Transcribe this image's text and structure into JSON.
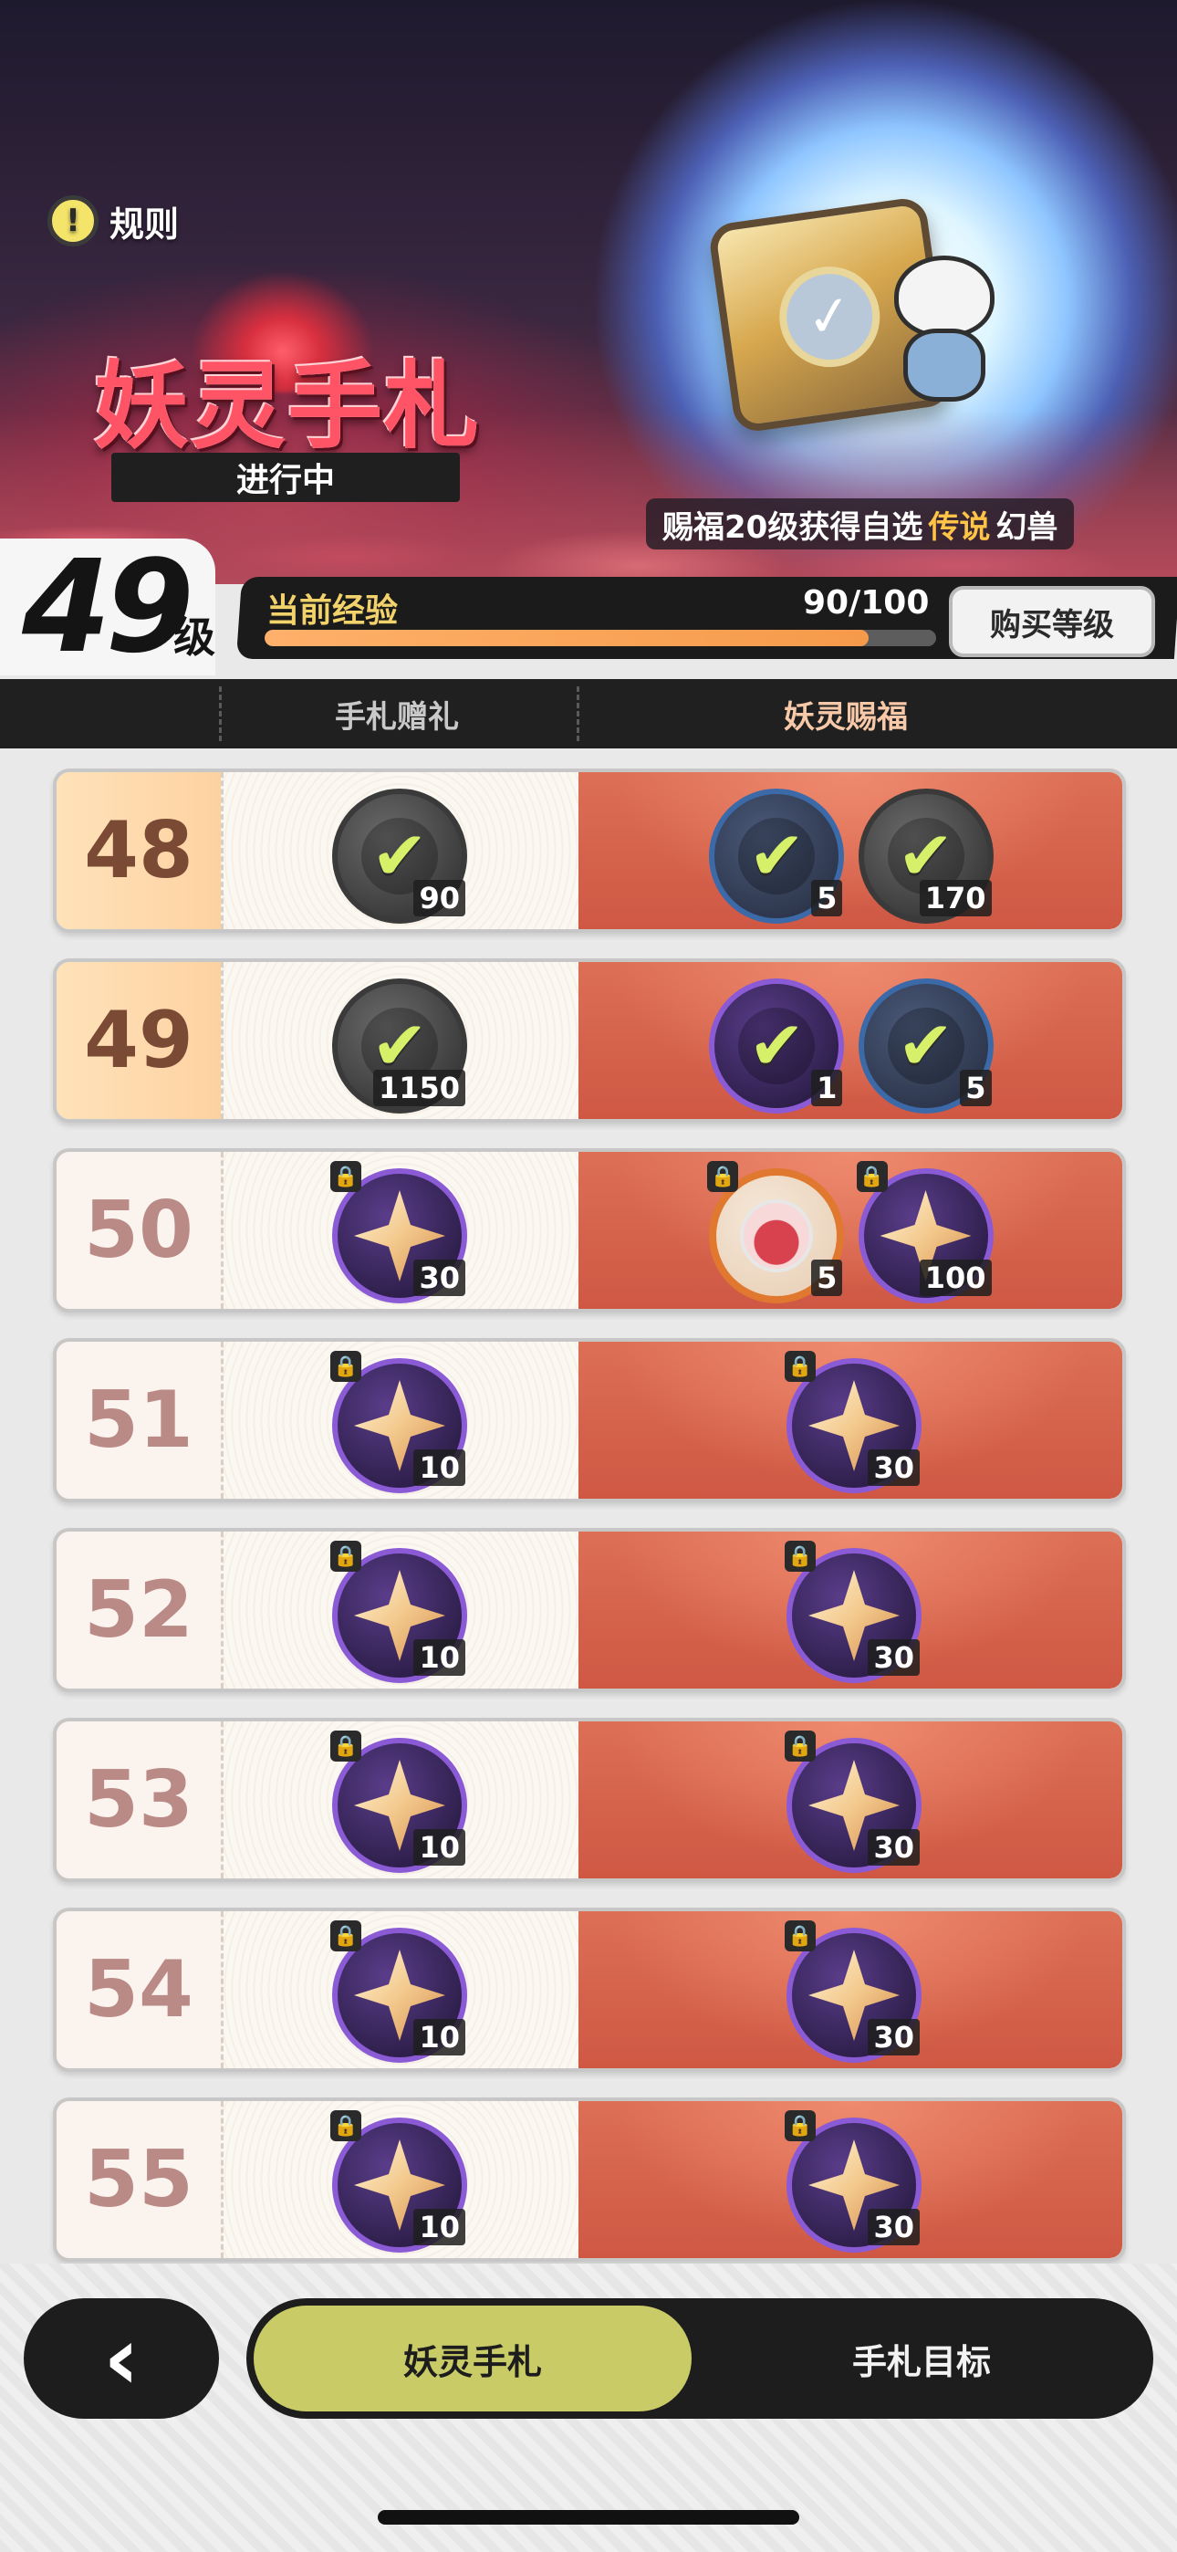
{
  "banner": {
    "rules_label": "规则",
    "event_title": "妖灵手札",
    "status": "进行中",
    "reward_caption_prefix": "赐福20级获得自选",
    "reward_caption_highlight": "传说",
    "reward_caption_suffix": "幻兽"
  },
  "level": {
    "current": "49",
    "unit": "级",
    "exp_label": "当前经验",
    "exp_text": "90/100",
    "exp_progress_percent": 90,
    "buy_label": "购买等级"
  },
  "columns": {
    "free_header": "手札赠礼",
    "paid_header": "妖灵赐福"
  },
  "rows": [
    {
      "level": "48",
      "state": "reached",
      "free": [
        {
          "icon": "bag-icon",
          "tier": "gray",
          "qty": "90",
          "claimed": true
        }
      ],
      "paid": [
        {
          "icon": "stone-icon",
          "tier": "blue",
          "qty": "5",
          "claimed": true
        },
        {
          "icon": "bag-icon",
          "tier": "gray",
          "qty": "170",
          "claimed": true
        }
      ]
    },
    {
      "level": "49",
      "state": "reached",
      "free": [
        {
          "icon": "orb-icon",
          "tier": "gray",
          "qty": "1150",
          "claimed": true
        }
      ],
      "paid": [
        {
          "icon": "scroll-icon",
          "tier": "purple",
          "qty": "1",
          "claimed": true
        },
        {
          "icon": "pickaxe-icon",
          "tier": "blue",
          "qty": "5",
          "claimed": true
        }
      ]
    },
    {
      "level": "50",
      "state": "locked",
      "free": [
        {
          "icon": "star-crystal-icon",
          "tier": "purple",
          "qty": "30",
          "claimed": false
        }
      ],
      "paid": [
        {
          "icon": "paw-token-icon",
          "tier": "orange",
          "qty": "5",
          "claimed": false
        },
        {
          "icon": "star-crystal-icon",
          "tier": "purple",
          "qty": "100",
          "claimed": false
        }
      ]
    },
    {
      "level": "51",
      "state": "locked",
      "free": [
        {
          "icon": "star-crystal-icon",
          "tier": "purple",
          "qty": "10",
          "claimed": false
        }
      ],
      "paid": [
        {
          "icon": "star-crystal-icon",
          "tier": "purple",
          "qty": "30",
          "claimed": false
        }
      ]
    },
    {
      "level": "52",
      "state": "locked",
      "free": [
        {
          "icon": "star-crystal-icon",
          "tier": "purple",
          "qty": "10",
          "claimed": false
        }
      ],
      "paid": [
        {
          "icon": "star-crystal-icon",
          "tier": "purple",
          "qty": "30",
          "claimed": false
        }
      ]
    },
    {
      "level": "53",
      "state": "locked",
      "free": [
        {
          "icon": "star-crystal-icon",
          "tier": "purple",
          "qty": "10",
          "claimed": false
        }
      ],
      "paid": [
        {
          "icon": "star-crystal-icon",
          "tier": "purple",
          "qty": "30",
          "claimed": false
        }
      ]
    },
    {
      "level": "54",
      "state": "locked",
      "free": [
        {
          "icon": "star-crystal-icon",
          "tier": "purple",
          "qty": "10",
          "claimed": false
        }
      ],
      "paid": [
        {
          "icon": "star-crystal-icon",
          "tier": "purple",
          "qty": "30",
          "claimed": false
        }
      ]
    },
    {
      "level": "55",
      "state": "locked",
      "free": [
        {
          "icon": "star-crystal-icon",
          "tier": "purple",
          "qty": "10",
          "claimed": false
        }
      ],
      "paid": [
        {
          "icon": "star-crystal-icon",
          "tier": "purple",
          "qty": "30",
          "claimed": false
        }
      ]
    }
  ],
  "nav": {
    "back_icon": "chevron-left-icon",
    "back_glyph": "‹",
    "tab_active": "妖灵手札",
    "tab_inactive": "手札目标"
  },
  "colors": {
    "accent_tab": "#c9cc66",
    "exp_fill": "#f59a4a",
    "paid_bg": "#d5604a",
    "check": "#d7f06a"
  }
}
